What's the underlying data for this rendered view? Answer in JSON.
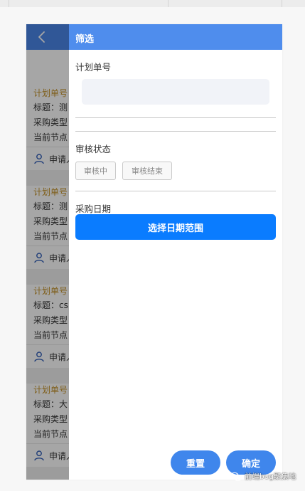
{
  "list": {
    "cards": [
      {
        "title": "计划单号",
        "subject": "标题：测",
        "purchase_type": "采购类型",
        "current_node": "当前节点",
        "applicant": "申请人"
      },
      {
        "title": "计划单号",
        "subject": "标题：测",
        "purchase_type": "采购类型",
        "current_node": "当前节点",
        "applicant": "申请人"
      },
      {
        "title": "计划单号",
        "subject": "标题：cs",
        "purchase_type": "采购类型",
        "current_node": "当前节点",
        "applicant": "申请人"
      },
      {
        "title": "计划单号",
        "subject": "标题：大",
        "purchase_type": "采购类型",
        "current_node": "当前节点",
        "applicant": "申请人"
      }
    ]
  },
  "filter": {
    "title": "筛选",
    "plan_no": {
      "label": "计划单号",
      "value": ""
    },
    "review_status": {
      "label": "审核状态",
      "options": [
        "审核中",
        "审核结束"
      ]
    },
    "purchase_date": {
      "label": "采购日期",
      "button_label": "选择日期范围"
    },
    "reset_label": "重置",
    "confirm_label": "确定"
  },
  "watermark": {
    "text": "前端bug聚集地"
  },
  "colors": {
    "header_bg": "#4f8ded",
    "primary_button": "#0a7cff",
    "pill_button": "#3f86ec",
    "card_title": "#c4922a",
    "overlay": "rgba(0,0,0,0.35)"
  },
  "icons": {
    "back": "chevron-left-icon",
    "applicant": "person-icon",
    "watermark": "wechat-icon"
  }
}
